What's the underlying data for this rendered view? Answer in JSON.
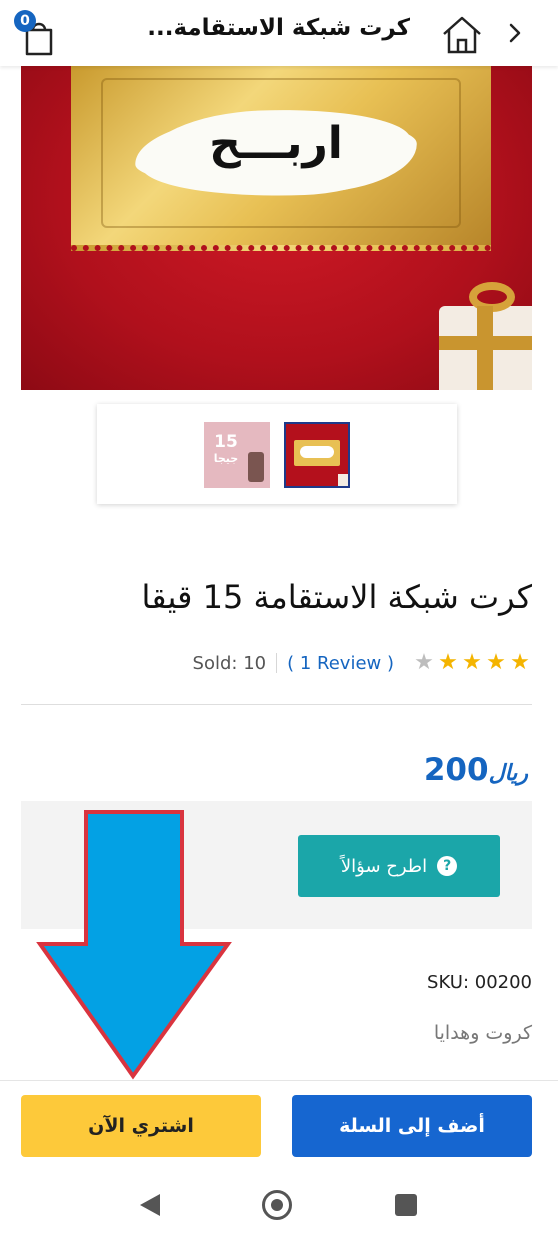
{
  "header": {
    "cart_count": "0",
    "title": "كرت شبكة الاستقامة...",
    "home_icon": "home-icon",
    "back_icon": "chevron-right-icon",
    "cart_icon": "shopping-bag-icon"
  },
  "hero": {
    "image_text": "اربـــح"
  },
  "thumbnails": {
    "thumb2_number": "15",
    "thumb2_text": "جيجا"
  },
  "product": {
    "title": "كرت شبكة الاستقامة 15 قيقا",
    "rating": 4,
    "rating_max": 5,
    "review_text": "( 1 Review )",
    "sold_text": "Sold: 10",
    "price": "200",
    "currency": "ريال",
    "ask_button": "اطرح سؤالاً",
    "sku": "SKU: 00200",
    "category": "كروت وهدايا"
  },
  "actions": {
    "add_to_cart": "أضف إلى السلة",
    "buy_now": "اشتري الآن"
  },
  "colors": {
    "accent_blue": "#1666d0",
    "buy_yellow": "#fdc93a",
    "teal": "#1ba6a9",
    "star": "#f4b400",
    "annotation_arrow": "#03a1e4",
    "annotation_border": "#d9343f"
  }
}
